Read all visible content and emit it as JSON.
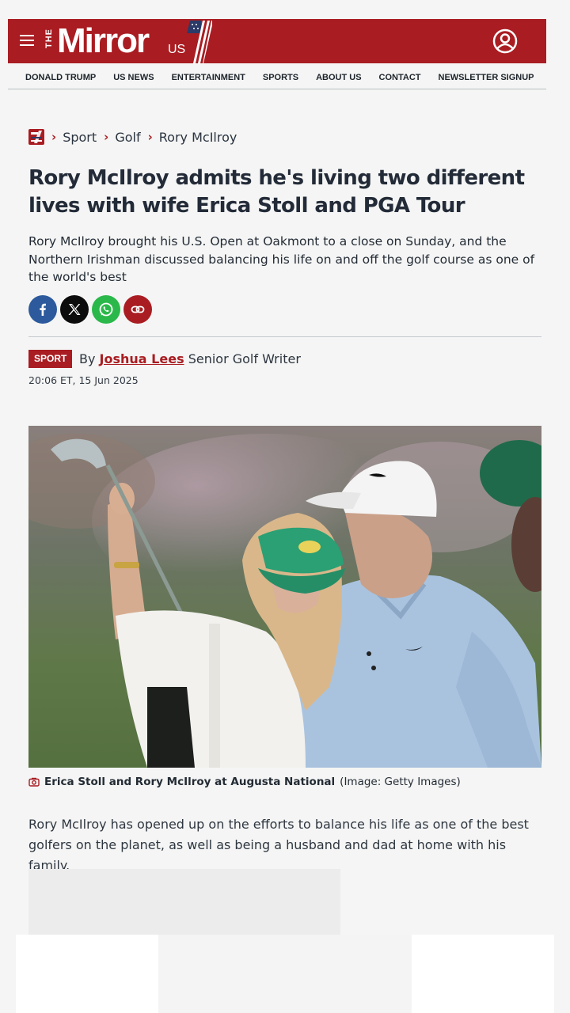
{
  "header": {
    "logo_the": "THE",
    "logo_main": "Mirror",
    "logo_us": "US"
  },
  "nav": [
    "DONALD TRUMP",
    "US NEWS",
    "ENTERTAINMENT",
    "SPORTS",
    "ABOUT US",
    "CONTACT",
    "NEWSLETTER SIGNUP"
  ],
  "breadcrumb": [
    "Sport",
    "Golf",
    "Rory McIlroy"
  ],
  "article": {
    "headline": "Rory McIlroy admits he's living two different lives with wife Erica Stoll and PGA Tour",
    "standfirst": "Rory McIlroy brought his U.S. Open at Oakmont to a close on Sunday, and the Northern Irishman discussed balancing his life on and off the golf course as one of the world's best",
    "section_badge": "SPORT",
    "by": "By",
    "author": "Joshua Lees",
    "author_role": "Senior Golf Writer",
    "timestamp": "20:06 ET, 15 Jun 2025",
    "caption": "Erica Stoll and Rory McIlroy at Augusta National",
    "credit": "(Image: Getty Images)",
    "first_paragraph": "Rory McIlroy has opened up on the efforts to balance his life as one of the best golfers on the planet, as well as being a husband and dad at home with his family."
  },
  "share_icons": [
    "facebook-icon",
    "x-icon",
    "whatsapp-icon",
    "link-icon"
  ],
  "colors": {
    "brand_red": "#a91d22",
    "facebook": "#2c5a9d",
    "x": "#0c0c0c",
    "whatsapp": "#2bb84a",
    "background": "#f4f5f4"
  }
}
